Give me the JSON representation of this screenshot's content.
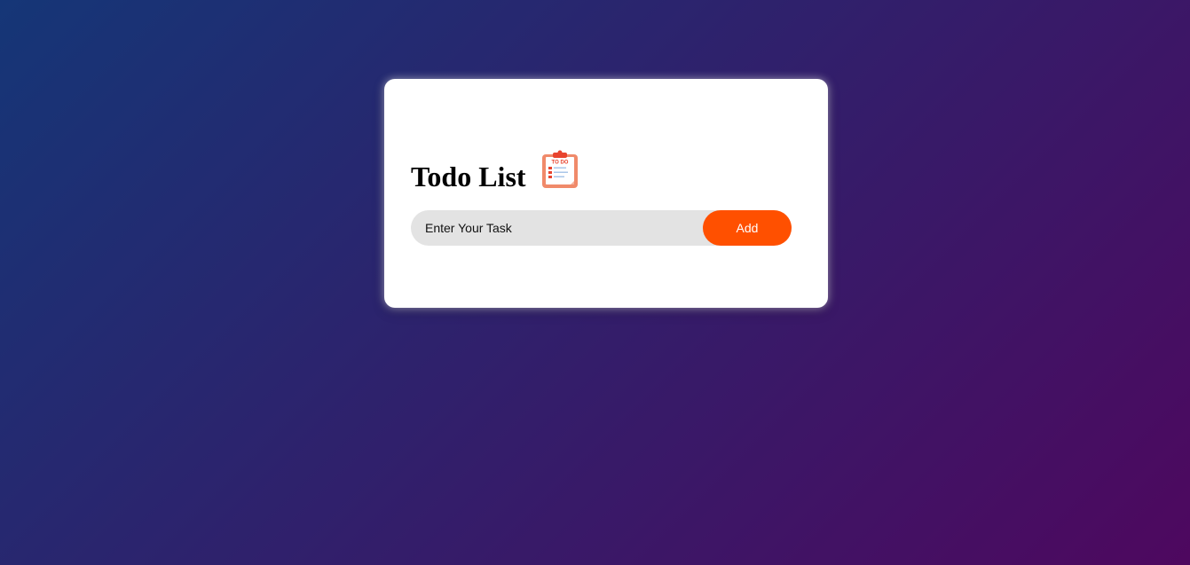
{
  "app": {
    "heading": "Todo List",
    "heading_icon": "todo-clipboard-icon",
    "icon_text": "TO DO"
  },
  "task_input": {
    "placeholder": "Enter Your Task",
    "value": ""
  },
  "add_button": {
    "label": "Add"
  },
  "colors": {
    "background_start": "#153677",
    "background_end": "#4e085f",
    "card": "#ffffff",
    "input_background": "#e3e3e3",
    "accent": "#ff5000"
  }
}
